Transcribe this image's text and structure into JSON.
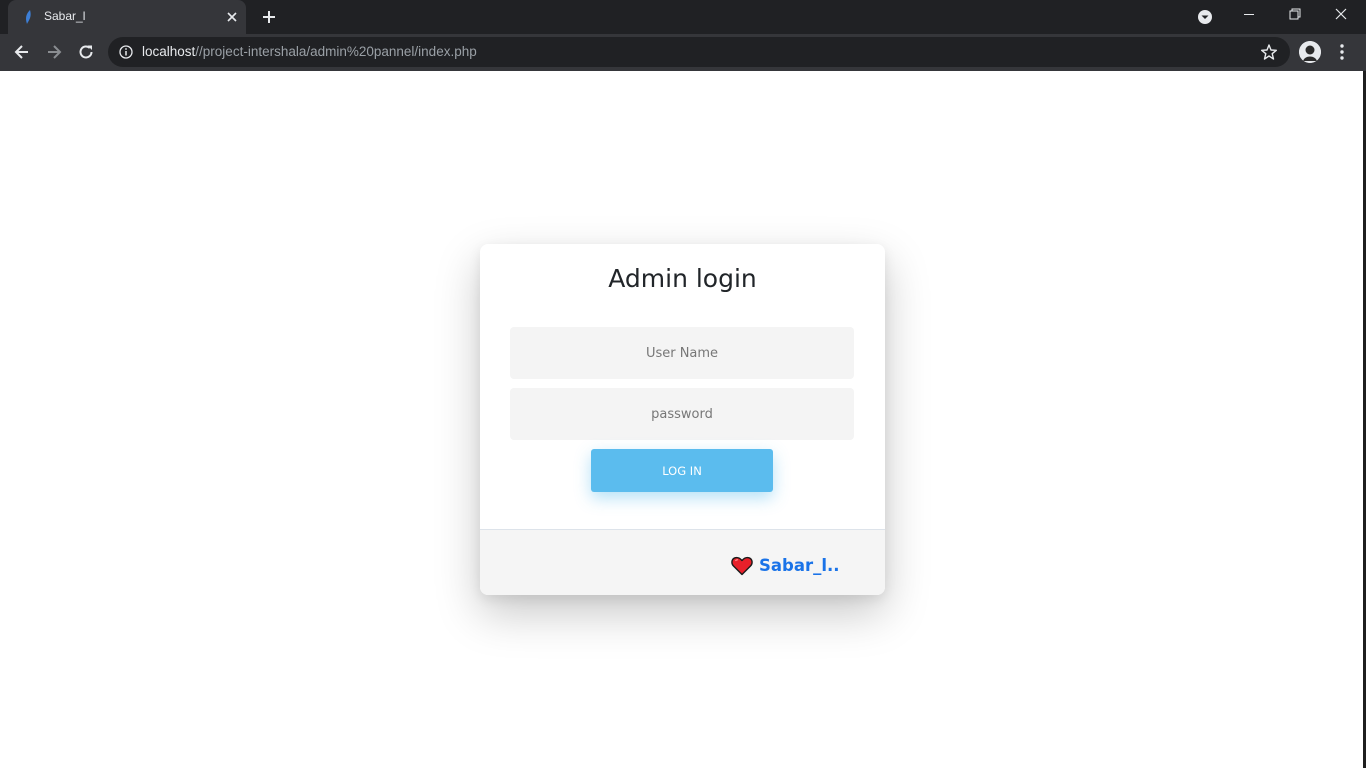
{
  "browser": {
    "tab_title": "Sabar_l",
    "url_host": "localhost",
    "url_path": "//project-intershala/admin%20pannel/index.php"
  },
  "login": {
    "title": "Admin login",
    "username_placeholder": "User Name",
    "password_placeholder": "password",
    "button_label": "LOG IN"
  },
  "footer": {
    "signature": "Sabar_l..",
    "heart_icon": "heart-icon"
  },
  "colors": {
    "button": "#5bbcee",
    "footer_link": "#1a73e8",
    "heart": "#e8202a"
  }
}
